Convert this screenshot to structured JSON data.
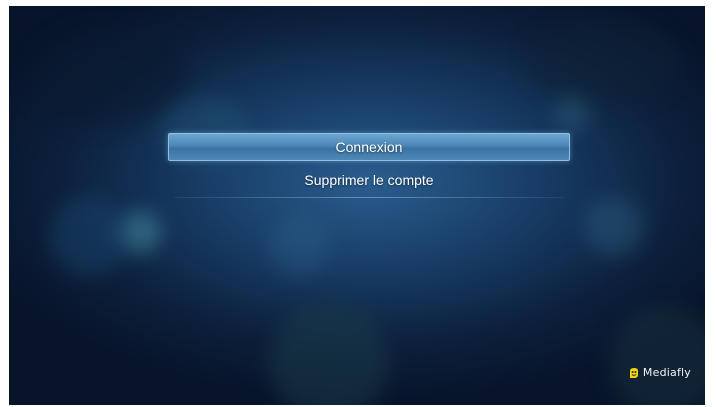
{
  "menu": {
    "items": [
      {
        "label": "Connexion",
        "selected": true
      },
      {
        "label": "Supprimer le compte",
        "selected": false
      }
    ]
  },
  "brand": {
    "name": "Mediafly",
    "icon": "mediafly-logo-icon",
    "accent_color": "#f2d21a"
  },
  "colors": {
    "selection_highlight": "#4b86b6",
    "background": "#0c1f3b"
  }
}
